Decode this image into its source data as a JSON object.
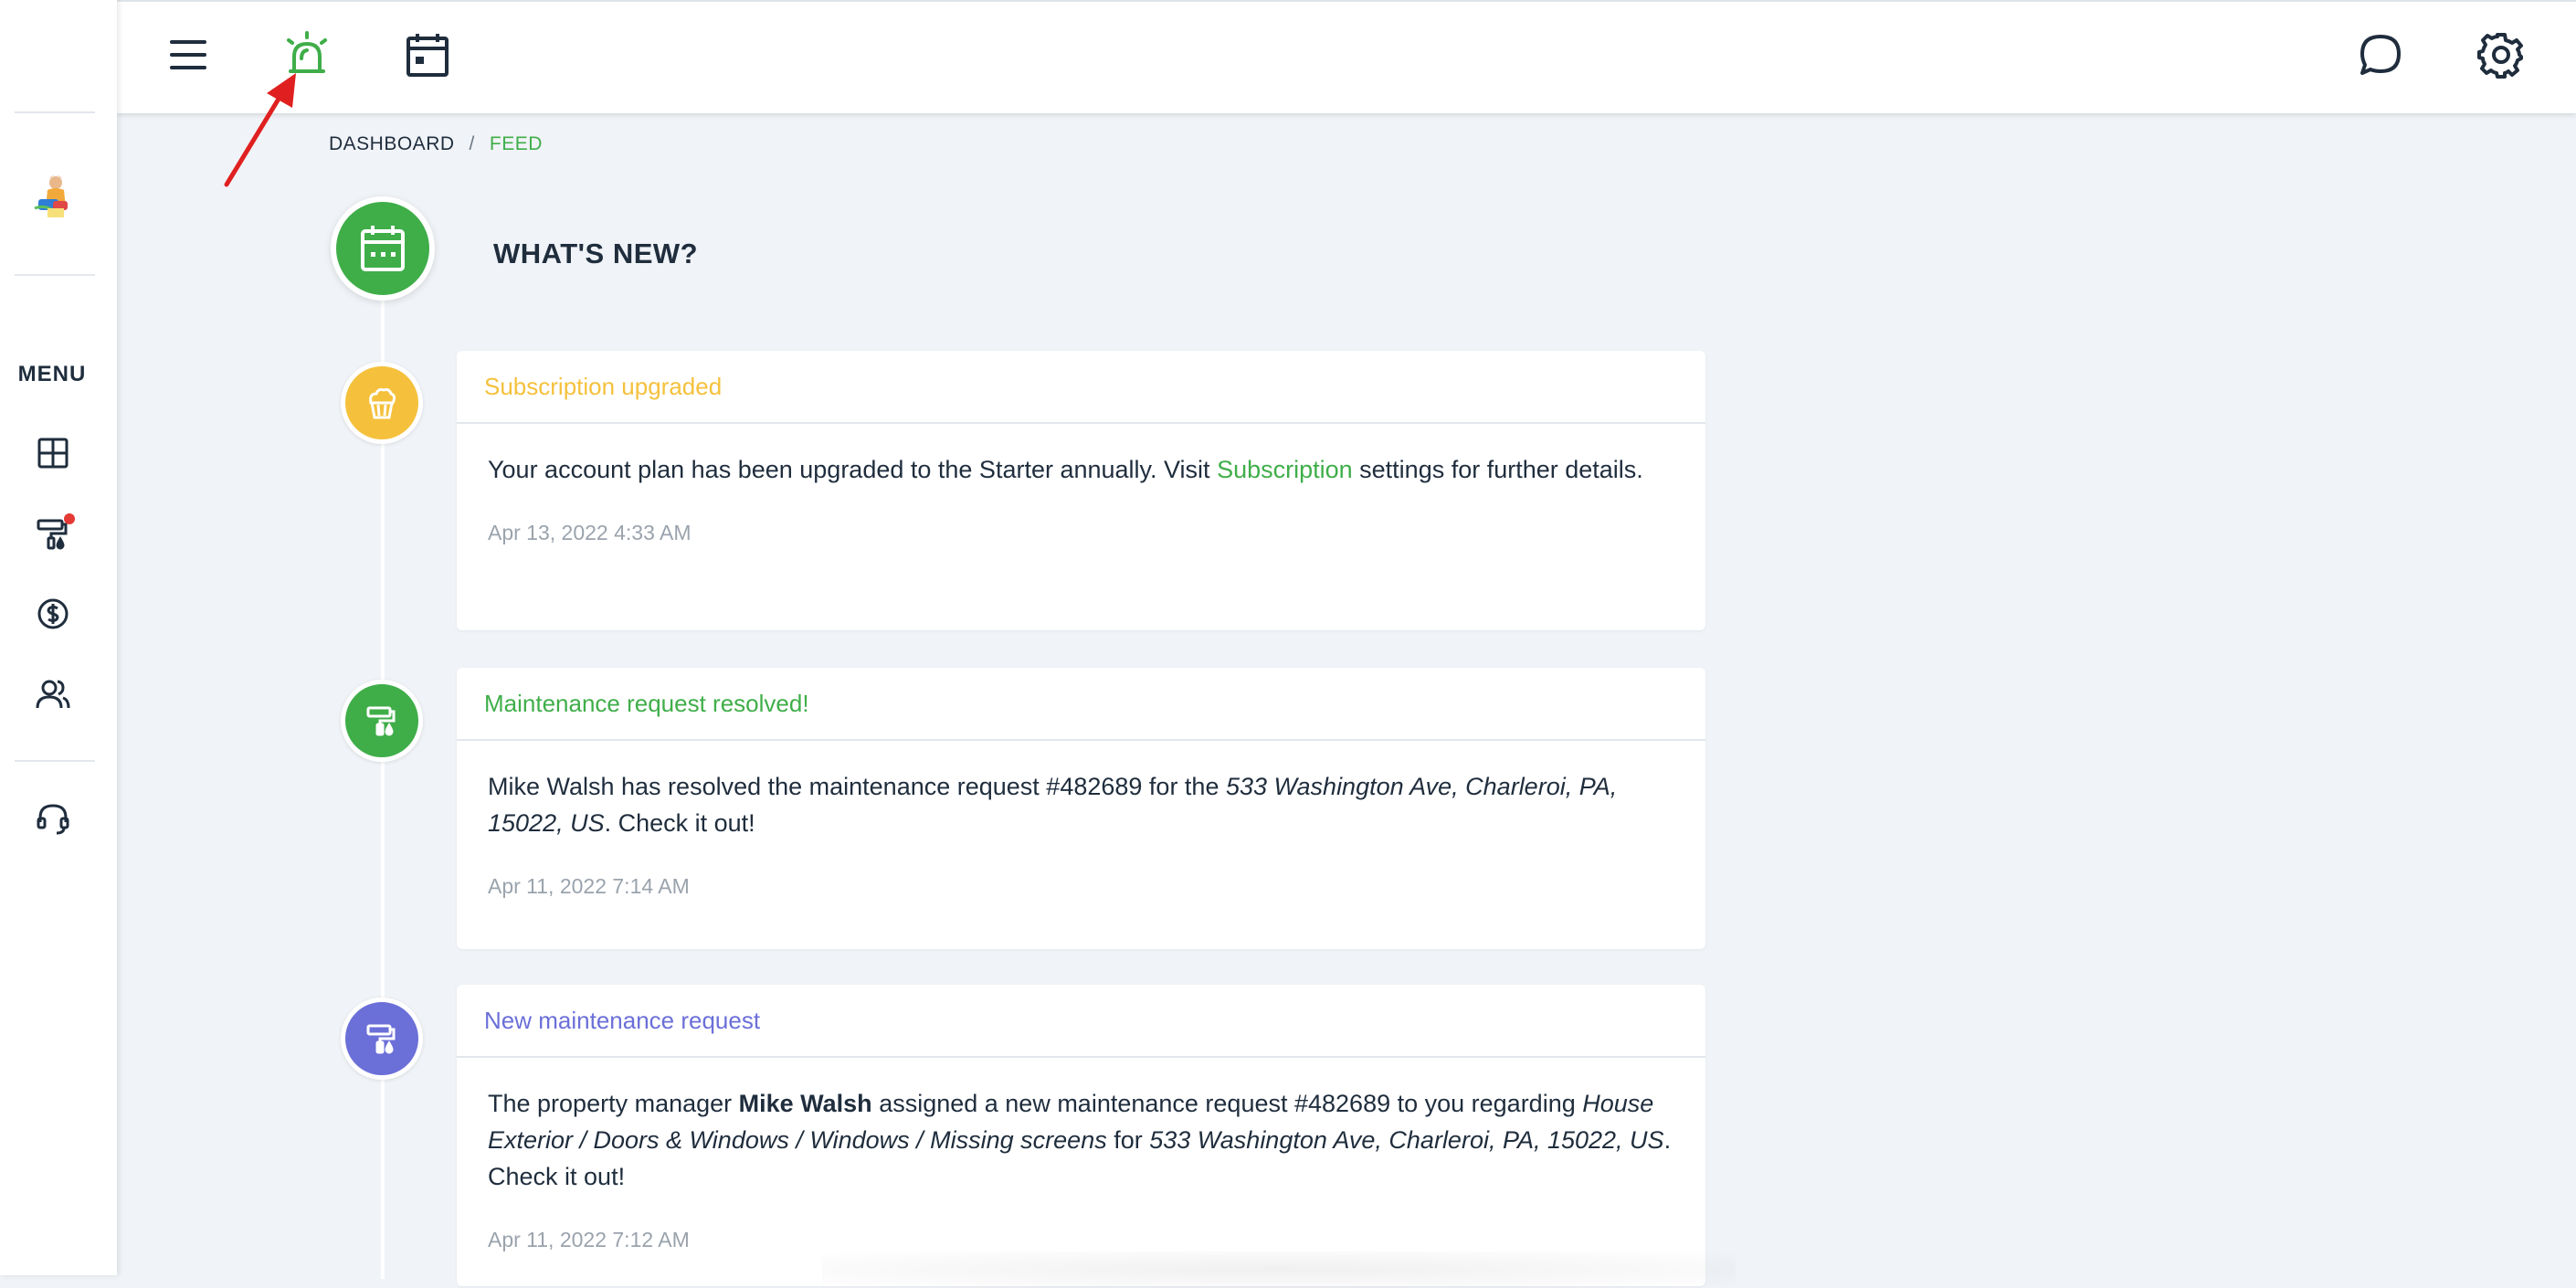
{
  "colors": {
    "accent_green": "#3fae49",
    "yellow": "#f5c13c",
    "purple": "#6b6fd8",
    "notification_red": "#e53935",
    "annotation_arrow": "#e02020"
  },
  "header": {
    "icons": [
      "menu-icon",
      "alarm-icon",
      "calendar-icon",
      "chat-icon",
      "gear-icon"
    ]
  },
  "sidebar": {
    "menu_label": "MENU",
    "items": [
      "dashboard-icon",
      "maintenance-icon",
      "payments-icon",
      "people-icon",
      "support-icon"
    ]
  },
  "breadcrumb": {
    "root": "DASHBOARD",
    "separator": "/",
    "current": "FEED"
  },
  "page": {
    "title": "WHAT'S NEW?"
  },
  "feed": [
    {
      "title": "Subscription upgraded",
      "body_pre": "Your account plan has been upgraded to the Starter annually. Visit ",
      "body_link": "Subscription",
      "body_post": " settings for further details.",
      "date": "Apr 13, 2022 4:33 AM",
      "icon": "cake-icon",
      "color": "#f5c13c"
    },
    {
      "title": "Maintenance request resolved!",
      "body_pre": "Mike Walsh has resolved the maintenance request #482689 for the ",
      "body_address": "533 Washington Ave, Charleroi, PA, 15022, US",
      "body_post": ". Check it out!",
      "date": "Apr 11, 2022 7:14 AM",
      "icon": "paint-roller-icon",
      "color": "#3fae49"
    },
    {
      "title": "New maintenance request",
      "body_pre": "The property manager ",
      "body_name": "Mike Walsh",
      "body_mid": " assigned a new maintenance request #482689 to you regarding ",
      "body_category": "House Exterior / Doors & Windows / Windows / Missing screens",
      "body_for": " for ",
      "body_address": "533 Washington Ave, Charleroi, PA, 15022, US",
      "body_post": ". Check it out!",
      "date": "Apr 11, 2022 7:12 AM",
      "icon": "paint-roller-icon",
      "color": "#6b6fd8"
    }
  ]
}
